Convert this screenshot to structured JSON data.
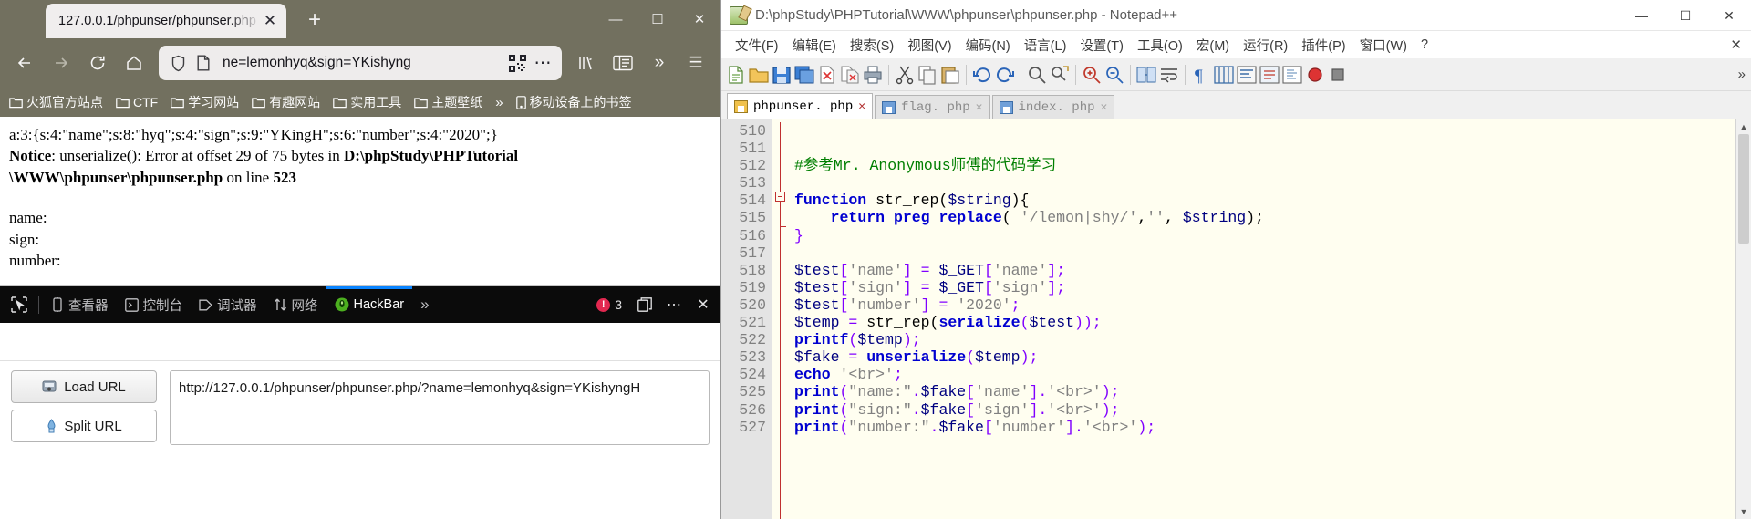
{
  "browser": {
    "tab": {
      "title": "127.0.0.1/phpunser/phpunser.php",
      "close": "✕"
    },
    "newtab_label": "+",
    "window_controls": {
      "minimize": "—",
      "maximize": "☐",
      "close": "✕"
    },
    "nav": {
      "back": "←",
      "forward": "→",
      "reload": "⟳",
      "home": "⌂"
    },
    "urlbar": {
      "value": "ne=lemonhyq&sign=YKishyng",
      "shield_icon": "shield-icon",
      "page_icon": "page-icon",
      "qr_icon": "qr-code-icon",
      "more": "⋯"
    },
    "toolbar_right": {
      "library": "library-icon",
      "reader": "reader-view-icon",
      "overflow": "»",
      "menu": "☰"
    },
    "bookmarks": [
      {
        "label": "火狐官方站点"
      },
      {
        "label": "CTF"
      },
      {
        "label": "学习网站"
      },
      {
        "label": "有趣网站"
      },
      {
        "label": "实用工具"
      },
      {
        "label": "主题壁纸"
      }
    ],
    "bookmarks_overflow": "»",
    "bookmarks_mobile": "移动设备上的书签"
  },
  "page": {
    "serialized": "a:3:{s:4:\"name\";s:8:\"hyq\";s:4:\"sign\";s:9:\"YKingH\";s:6:\"number\";s:4:\"2020\";}",
    "notice_label": "Notice",
    "notice_text_1": ": unserialize(): Error at offset 29 of 75 bytes in ",
    "notice_path_1": "D:\\phpStudy\\PHPTutorial",
    "notice_path_2": "\\WWW\\phpunser\\phpunser.php",
    "notice_text_2": " on line ",
    "notice_line": "523",
    "name_line": "name:",
    "sign_line": "sign:",
    "number_line": "number:"
  },
  "devtools": {
    "picker_icon": "element-picker-icon",
    "tabs": [
      {
        "label": "查看器",
        "icon": "inspector-icon",
        "active": false
      },
      {
        "label": "控制台",
        "icon": "console-icon",
        "active": false
      },
      {
        "label": "调试器",
        "icon": "debugger-icon",
        "active": false
      },
      {
        "label": "网络",
        "icon": "network-icon",
        "active": false
      },
      {
        "label": "HackBar",
        "icon": "hackbar-icon",
        "active": true
      }
    ],
    "overflow": "»",
    "error_count": "3",
    "dock_icon": "dock-layout-icon",
    "more_icon": "⋯",
    "close_icon": "✕",
    "error_color": "#e22850",
    "accent_color": "#0a84ff"
  },
  "hackbar": {
    "load_url_label": "Load URL",
    "split_url_label": "Split URL",
    "url_value": "http://127.0.0.1/phpunser/phpunser.php/?name=lemonhyq&sign=YKishyngH"
  },
  "notepad": {
    "title": "D:\\phpStudy\\PHPTutorial\\WWW\\phpunser\\phpunser.php - Notepad++",
    "window_controls": {
      "minimize": "—",
      "maximize": "☐",
      "close": "✕"
    },
    "menus": [
      "文件(F)",
      "编辑(E)",
      "搜索(S)",
      "视图(V)",
      "编码(N)",
      "语言(L)",
      "设置(T)",
      "工具(O)",
      "宏(M)",
      "运行(R)",
      "插件(P)",
      "窗口(W)",
      "?"
    ],
    "close_doc": "✕",
    "toolbar_overflow": "»",
    "tabs": [
      {
        "label": "phpunser. php",
        "close": "✕",
        "active": true
      },
      {
        "label": "flag. php",
        "close": "✕",
        "active": false
      },
      {
        "label": "index. php",
        "close": "✕",
        "active": false
      }
    ],
    "first_line_number": 510,
    "lines": [
      {
        "n": "510",
        "tokens": []
      },
      {
        "n": "511",
        "tokens": []
      },
      {
        "n": "512",
        "tokens": [
          {
            "t": "#参考Mr. Anonymous师傅的代码学习",
            "c": "cmt"
          }
        ]
      },
      {
        "n": "513",
        "tokens": []
      },
      {
        "n": "514",
        "tokens": [
          {
            "t": "function",
            "c": "k"
          },
          {
            "t": " str_rep(",
            "c": "sup"
          },
          {
            "t": "$string",
            "c": "var"
          },
          {
            "t": "){",
            "c": "sup"
          }
        ]
      },
      {
        "n": "515",
        "tokens": [
          {
            "t": "    ",
            "c": "sup"
          },
          {
            "t": "return",
            "c": "k"
          },
          {
            "t": " ",
            "c": "sup"
          },
          {
            "t": "preg_replace",
            "c": "fn"
          },
          {
            "t": "( ",
            "c": "sup"
          },
          {
            "t": "'/lemon|shy/'",
            "c": "str"
          },
          {
            "t": ",",
            "c": "sup"
          },
          {
            "t": "''",
            "c": "str"
          },
          {
            "t": ", ",
            "c": "sup"
          },
          {
            "t": "$string",
            "c": "var"
          },
          {
            "t": ");",
            "c": "sup"
          }
        ]
      },
      {
        "n": "516",
        "tokens": [
          {
            "t": "}",
            "c": "op"
          }
        ]
      },
      {
        "n": "517",
        "tokens": []
      },
      {
        "n": "518",
        "tokens": [
          {
            "t": "$test",
            "c": "var"
          },
          {
            "t": "[",
            "c": "op"
          },
          {
            "t": "'name'",
            "c": "str"
          },
          {
            "t": "] = ",
            "c": "op"
          },
          {
            "t": "$_GET",
            "c": "var"
          },
          {
            "t": "[",
            "c": "op"
          },
          {
            "t": "'name'",
            "c": "str"
          },
          {
            "t": "];",
            "c": "op"
          }
        ]
      },
      {
        "n": "519",
        "tokens": [
          {
            "t": "$test",
            "c": "var"
          },
          {
            "t": "[",
            "c": "op"
          },
          {
            "t": "'sign'",
            "c": "str"
          },
          {
            "t": "] = ",
            "c": "op"
          },
          {
            "t": "$_GET",
            "c": "var"
          },
          {
            "t": "[",
            "c": "op"
          },
          {
            "t": "'sign'",
            "c": "str"
          },
          {
            "t": "];",
            "c": "op"
          }
        ]
      },
      {
        "n": "520",
        "tokens": [
          {
            "t": "$test",
            "c": "var"
          },
          {
            "t": "[",
            "c": "op"
          },
          {
            "t": "'number'",
            "c": "str"
          },
          {
            "t": "] = ",
            "c": "op"
          },
          {
            "t": "'2020'",
            "c": "str"
          },
          {
            "t": ";",
            "c": "op"
          }
        ]
      },
      {
        "n": "521",
        "tokens": [
          {
            "t": "$temp",
            "c": "var"
          },
          {
            "t": " = ",
            "c": "op"
          },
          {
            "t": "str_rep(",
            "c": "sup"
          },
          {
            "t": "serialize",
            "c": "fn"
          },
          {
            "t": "(",
            "c": "op"
          },
          {
            "t": "$test",
            "c": "var"
          },
          {
            "t": "));",
            "c": "op"
          }
        ]
      },
      {
        "n": "522",
        "tokens": [
          {
            "t": "printf",
            "c": "fn"
          },
          {
            "t": "(",
            "c": "op"
          },
          {
            "t": "$temp",
            "c": "var"
          },
          {
            "t": ");",
            "c": "op"
          }
        ]
      },
      {
        "n": "523",
        "tokens": [
          {
            "t": "$fake",
            "c": "var"
          },
          {
            "t": " = ",
            "c": "op"
          },
          {
            "t": "unserialize",
            "c": "fn"
          },
          {
            "t": "(",
            "c": "op"
          },
          {
            "t": "$temp",
            "c": "var"
          },
          {
            "t": ");",
            "c": "op"
          }
        ]
      },
      {
        "n": "524",
        "tokens": [
          {
            "t": "echo",
            "c": "k"
          },
          {
            "t": " ",
            "c": "sup"
          },
          {
            "t": "'<br>'",
            "c": "str"
          },
          {
            "t": ";",
            "c": "op"
          }
        ]
      },
      {
        "n": "525",
        "tokens": [
          {
            "t": "print",
            "c": "k"
          },
          {
            "t": "(",
            "c": "op"
          },
          {
            "t": "\"name:\"",
            "c": "str"
          },
          {
            "t": ".",
            "c": "op"
          },
          {
            "t": "$fake",
            "c": "var"
          },
          {
            "t": "[",
            "c": "op"
          },
          {
            "t": "'name'",
            "c": "str"
          },
          {
            "t": "].",
            "c": "op"
          },
          {
            "t": "'<br>'",
            "c": "str"
          },
          {
            "t": ");",
            "c": "op"
          }
        ]
      },
      {
        "n": "526",
        "tokens": [
          {
            "t": "print",
            "c": "k"
          },
          {
            "t": "(",
            "c": "op"
          },
          {
            "t": "\"sign:\"",
            "c": "str"
          },
          {
            "t": ".",
            "c": "op"
          },
          {
            "t": "$fake",
            "c": "var"
          },
          {
            "t": "[",
            "c": "op"
          },
          {
            "t": "'sign'",
            "c": "str"
          },
          {
            "t": "].",
            "c": "op"
          },
          {
            "t": "'<br>'",
            "c": "str"
          },
          {
            "t": ");",
            "c": "op"
          }
        ]
      },
      {
        "n": "527",
        "tokens": [
          {
            "t": "print",
            "c": "k"
          },
          {
            "t": "(",
            "c": "op"
          },
          {
            "t": "\"number:\"",
            "c": "str"
          },
          {
            "t": ".",
            "c": "op"
          },
          {
            "t": "$fake",
            "c": "var"
          },
          {
            "t": "[",
            "c": "op"
          },
          {
            "t": "'number'",
            "c": "str"
          },
          {
            "t": "].",
            "c": "op"
          },
          {
            "t": "'<br>'",
            "c": "str"
          },
          {
            "t": ");",
            "c": "op"
          }
        ]
      }
    ]
  }
}
